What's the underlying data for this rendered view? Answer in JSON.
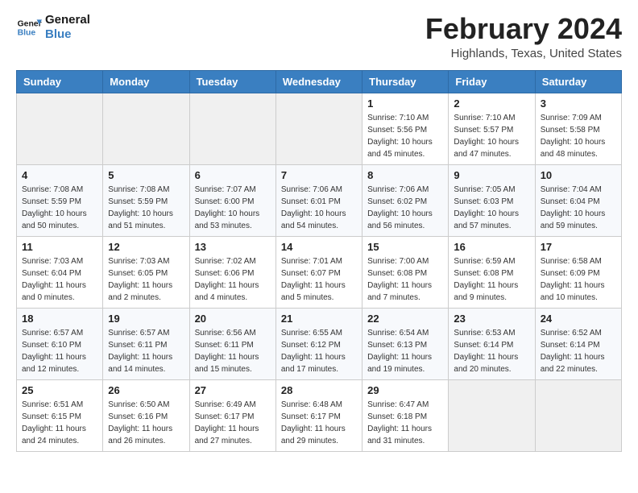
{
  "header": {
    "logo_line1": "General",
    "logo_line2": "Blue",
    "month_title": "February 2024",
    "location": "Highlands, Texas, United States"
  },
  "weekdays": [
    "Sunday",
    "Monday",
    "Tuesday",
    "Wednesday",
    "Thursday",
    "Friday",
    "Saturday"
  ],
  "weeks": [
    [
      {
        "day": "",
        "info": ""
      },
      {
        "day": "",
        "info": ""
      },
      {
        "day": "",
        "info": ""
      },
      {
        "day": "",
        "info": ""
      },
      {
        "day": "1",
        "info": "Sunrise: 7:10 AM\nSunset: 5:56 PM\nDaylight: 10 hours\nand 45 minutes."
      },
      {
        "day": "2",
        "info": "Sunrise: 7:10 AM\nSunset: 5:57 PM\nDaylight: 10 hours\nand 47 minutes."
      },
      {
        "day": "3",
        "info": "Sunrise: 7:09 AM\nSunset: 5:58 PM\nDaylight: 10 hours\nand 48 minutes."
      }
    ],
    [
      {
        "day": "4",
        "info": "Sunrise: 7:08 AM\nSunset: 5:59 PM\nDaylight: 10 hours\nand 50 minutes."
      },
      {
        "day": "5",
        "info": "Sunrise: 7:08 AM\nSunset: 5:59 PM\nDaylight: 10 hours\nand 51 minutes."
      },
      {
        "day": "6",
        "info": "Sunrise: 7:07 AM\nSunset: 6:00 PM\nDaylight: 10 hours\nand 53 minutes."
      },
      {
        "day": "7",
        "info": "Sunrise: 7:06 AM\nSunset: 6:01 PM\nDaylight: 10 hours\nand 54 minutes."
      },
      {
        "day": "8",
        "info": "Sunrise: 7:06 AM\nSunset: 6:02 PM\nDaylight: 10 hours\nand 56 minutes."
      },
      {
        "day": "9",
        "info": "Sunrise: 7:05 AM\nSunset: 6:03 PM\nDaylight: 10 hours\nand 57 minutes."
      },
      {
        "day": "10",
        "info": "Sunrise: 7:04 AM\nSunset: 6:04 PM\nDaylight: 10 hours\nand 59 minutes."
      }
    ],
    [
      {
        "day": "11",
        "info": "Sunrise: 7:03 AM\nSunset: 6:04 PM\nDaylight: 11 hours\nand 0 minutes."
      },
      {
        "day": "12",
        "info": "Sunrise: 7:03 AM\nSunset: 6:05 PM\nDaylight: 11 hours\nand 2 minutes."
      },
      {
        "day": "13",
        "info": "Sunrise: 7:02 AM\nSunset: 6:06 PM\nDaylight: 11 hours\nand 4 minutes."
      },
      {
        "day": "14",
        "info": "Sunrise: 7:01 AM\nSunset: 6:07 PM\nDaylight: 11 hours\nand 5 minutes."
      },
      {
        "day": "15",
        "info": "Sunrise: 7:00 AM\nSunset: 6:08 PM\nDaylight: 11 hours\nand 7 minutes."
      },
      {
        "day": "16",
        "info": "Sunrise: 6:59 AM\nSunset: 6:08 PM\nDaylight: 11 hours\nand 9 minutes."
      },
      {
        "day": "17",
        "info": "Sunrise: 6:58 AM\nSunset: 6:09 PM\nDaylight: 11 hours\nand 10 minutes."
      }
    ],
    [
      {
        "day": "18",
        "info": "Sunrise: 6:57 AM\nSunset: 6:10 PM\nDaylight: 11 hours\nand 12 minutes."
      },
      {
        "day": "19",
        "info": "Sunrise: 6:57 AM\nSunset: 6:11 PM\nDaylight: 11 hours\nand 14 minutes."
      },
      {
        "day": "20",
        "info": "Sunrise: 6:56 AM\nSunset: 6:11 PM\nDaylight: 11 hours\nand 15 minutes."
      },
      {
        "day": "21",
        "info": "Sunrise: 6:55 AM\nSunset: 6:12 PM\nDaylight: 11 hours\nand 17 minutes."
      },
      {
        "day": "22",
        "info": "Sunrise: 6:54 AM\nSunset: 6:13 PM\nDaylight: 11 hours\nand 19 minutes."
      },
      {
        "day": "23",
        "info": "Sunrise: 6:53 AM\nSunset: 6:14 PM\nDaylight: 11 hours\nand 20 minutes."
      },
      {
        "day": "24",
        "info": "Sunrise: 6:52 AM\nSunset: 6:14 PM\nDaylight: 11 hours\nand 22 minutes."
      }
    ],
    [
      {
        "day": "25",
        "info": "Sunrise: 6:51 AM\nSunset: 6:15 PM\nDaylight: 11 hours\nand 24 minutes."
      },
      {
        "day": "26",
        "info": "Sunrise: 6:50 AM\nSunset: 6:16 PM\nDaylight: 11 hours\nand 26 minutes."
      },
      {
        "day": "27",
        "info": "Sunrise: 6:49 AM\nSunset: 6:17 PM\nDaylight: 11 hours\nand 27 minutes."
      },
      {
        "day": "28",
        "info": "Sunrise: 6:48 AM\nSunset: 6:17 PM\nDaylight: 11 hours\nand 29 minutes."
      },
      {
        "day": "29",
        "info": "Sunrise: 6:47 AM\nSunset: 6:18 PM\nDaylight: 11 hours\nand 31 minutes."
      },
      {
        "day": "",
        "info": ""
      },
      {
        "day": "",
        "info": ""
      }
    ]
  ]
}
